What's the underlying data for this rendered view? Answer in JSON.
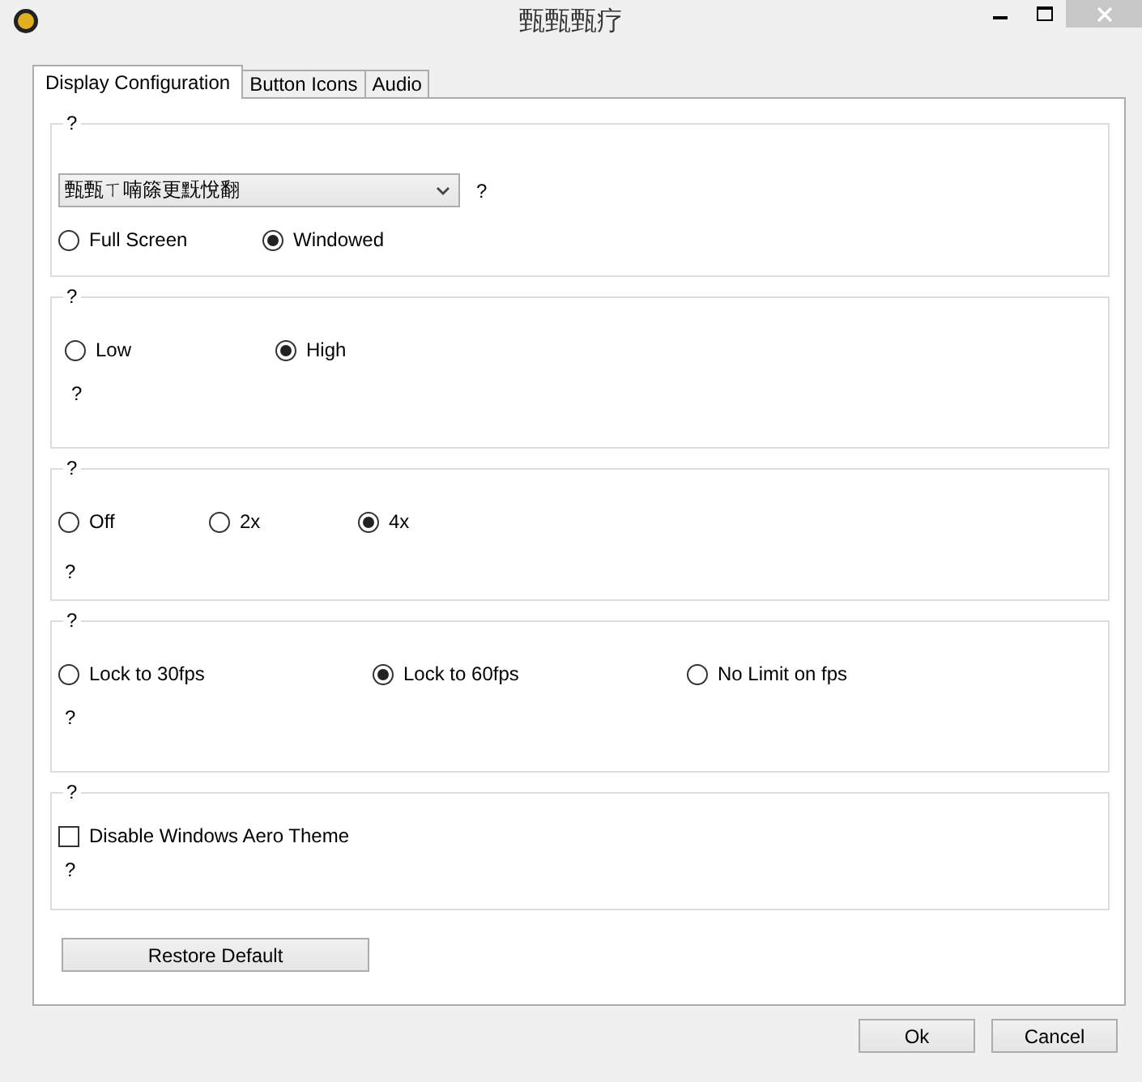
{
  "window": {
    "title": "甄甄甄疗"
  },
  "tabs": [
    {
      "label": "Display Configuration",
      "selected": true
    },
    {
      "label": "Button Icons",
      "selected": false
    },
    {
      "label": "Audio",
      "selected": false
    }
  ],
  "groups": [
    {
      "legend": "?",
      "dropdown": {
        "value": "甄甄ㄒ喃篨更黖悅翻",
        "hint": "?"
      },
      "radios": [
        {
          "label": "Full Screen",
          "selected": false
        },
        {
          "label": "Windowed",
          "selected": true
        }
      ]
    },
    {
      "legend": "?",
      "radios": [
        {
          "label": "Low",
          "selected": false
        },
        {
          "label": "High",
          "selected": true
        }
      ],
      "note": "?"
    },
    {
      "legend": "?",
      "radios": [
        {
          "label": "Off",
          "selected": false
        },
        {
          "label": "2x",
          "selected": false
        },
        {
          "label": "4x",
          "selected": true
        }
      ],
      "note": "?"
    },
    {
      "legend": "?",
      "radios": [
        {
          "label": "Lock  to 30fps",
          "selected": false
        },
        {
          "label": "Lock to 60fps",
          "selected": true
        },
        {
          "label": "No Limit on fps",
          "selected": false
        }
      ],
      "note": "?"
    },
    {
      "legend": "?",
      "checkbox": {
        "label": "Disable Windows Aero Theme",
        "checked": false
      },
      "note": "?"
    }
  ],
  "restore_button": "Restore Default",
  "buttons": [
    "Ok",
    "Cancel"
  ]
}
